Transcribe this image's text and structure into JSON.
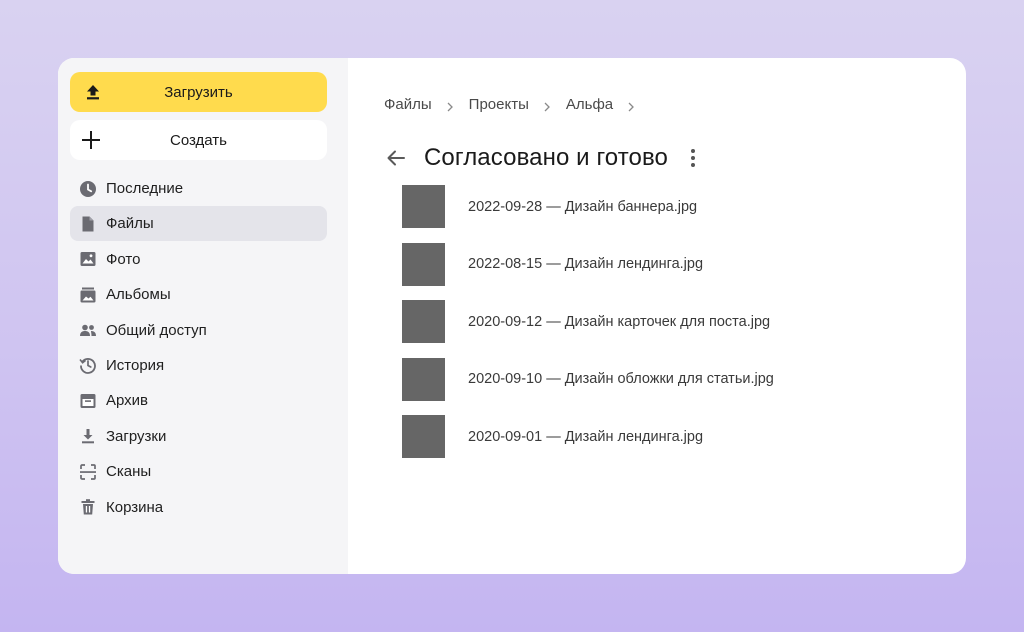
{
  "sidebar": {
    "upload_label": "Загрузить",
    "create_label": "Создать",
    "items": [
      {
        "label": "Последние",
        "icon": "clock-icon"
      },
      {
        "label": "Файлы",
        "icon": "file-icon",
        "active": true
      },
      {
        "label": "Фото",
        "icon": "photo-icon"
      },
      {
        "label": "Альбомы",
        "icon": "albums-icon"
      },
      {
        "label": "Общий доступ",
        "icon": "people-icon"
      },
      {
        "label": "История",
        "icon": "history-icon"
      },
      {
        "label": "Архив",
        "icon": "archive-icon"
      },
      {
        "label": "Загрузки",
        "icon": "download-icon"
      },
      {
        "label": "Сканы",
        "icon": "scan-icon"
      },
      {
        "label": "Корзина",
        "icon": "trash-icon"
      }
    ]
  },
  "breadcrumb": [
    "Файлы",
    "Проекты",
    "Альфа"
  ],
  "page_title": "Согласовано и готово",
  "files": [
    "2022-09-28 — Дизайн баннера.jpg",
    "2022-08-15 — Дизайн лендинга.jpg",
    "2020-09-12 — Дизайн карточек для поста.jpg",
    "2020-09-10 — Дизайн обложки для статьи.jpg",
    "2020-09-01 — Дизайн лендинга.jpg"
  ],
  "colors": {
    "accent": "#ffdb4d",
    "thumbnail": "#666666",
    "sidebar_bg": "#f5f5f7",
    "active_item": "#e4e4ea"
  }
}
